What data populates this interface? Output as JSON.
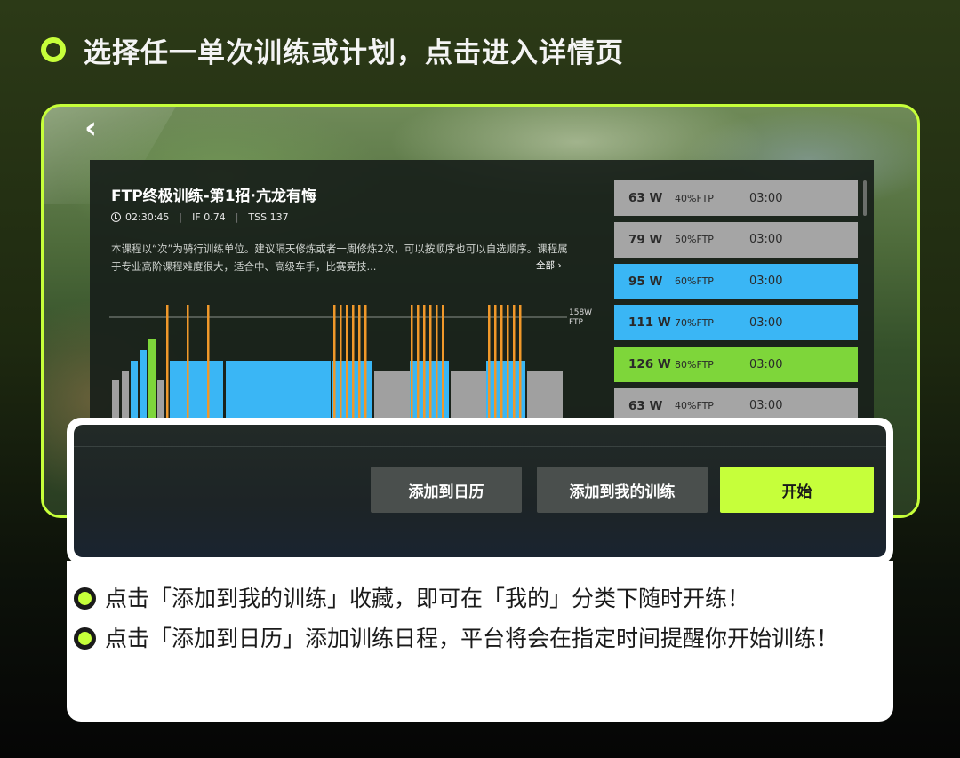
{
  "headline": "选择任一单次训练或计划，点击进入详情页",
  "course": {
    "title": "FTP终极训练-第1招·亢龙有悔",
    "duration": "02:30:45",
    "if": "IF 0.74",
    "tss": "TSS 137",
    "description": "本课程以“次”为骑行训练单位。建议隔天修炼或者一周修炼2次，可以按顺序也可以自选顺序。课程属于专业高阶课程难度很大，适合中、高级车手，比赛竞技...",
    "more_label": "全部",
    "back_label": "‹"
  },
  "chart_data": {
    "type": "bar",
    "title": "",
    "ftp_line_label": "158W",
    "ftp_line_sublabel": "FTP",
    "ftp_line_value": 158,
    "colors": {
      "gray": "#a0a0a0",
      "blue": "#3ab6f5",
      "green": "#7ed63a",
      "orange": "#f0982a"
    }
  },
  "intervals": [
    {
      "watts": "63 W",
      "ftp": "40%FTP",
      "time": "03:00",
      "color": "gray"
    },
    {
      "watts": "79 W",
      "ftp": "50%FTP",
      "time": "03:00",
      "color": "gray"
    },
    {
      "watts": "95 W",
      "ftp": "60%FTP",
      "time": "03:00",
      "color": "blue"
    },
    {
      "watts": "111 W",
      "ftp": "70%FTP",
      "time": "03:00",
      "color": "blue"
    },
    {
      "watts": "126 W",
      "ftp": "80%FTP",
      "time": "03:00",
      "color": "green"
    },
    {
      "watts": "63 W",
      "ftp": "40%FTP",
      "time": "03:00",
      "color": "gray"
    }
  ],
  "actions": {
    "add_calendar": "添加到日历",
    "add_mine": "添加到我的训练",
    "start": "开始"
  },
  "tips": [
    "点击「添加到我的训练」收藏，即可在「我的」分类下随时开练！",
    "点击「添加到日历」添加训练日程，平台将会在指定时间提醒你开始训练！"
  ]
}
